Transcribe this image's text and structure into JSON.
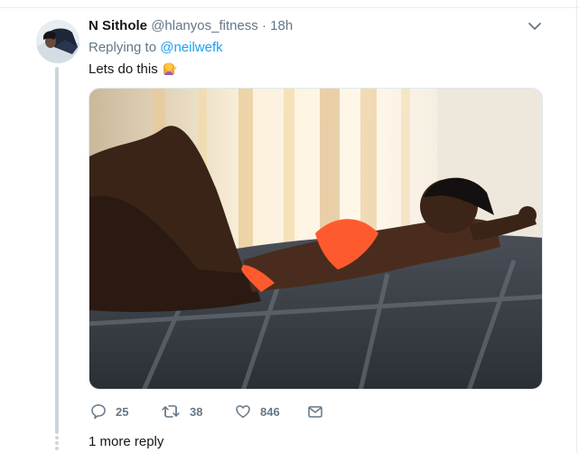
{
  "tweet": {
    "author_name": "N Sithole",
    "handle": "@hlanyos_fitness",
    "separator": "·",
    "time": "18h",
    "replying_prefix": "Replying to",
    "replying_to": "@neilwefk",
    "text": "Lets do this",
    "emoji_icon": "woman-tipping-hand-icon"
  },
  "actions": {
    "reply_count": "25",
    "retweet_count": "38",
    "like_count": "846",
    "reply_icon": "speech-bubble-icon",
    "retweet_icon": "retweet-icon",
    "like_icon": "heart-icon",
    "message_icon": "envelope-icon"
  },
  "thread": {
    "more_replies": "1 more reply"
  },
  "colors": {
    "link": "#1da1f2",
    "muted": "#657786",
    "thread_line": "#ccd6dd"
  }
}
